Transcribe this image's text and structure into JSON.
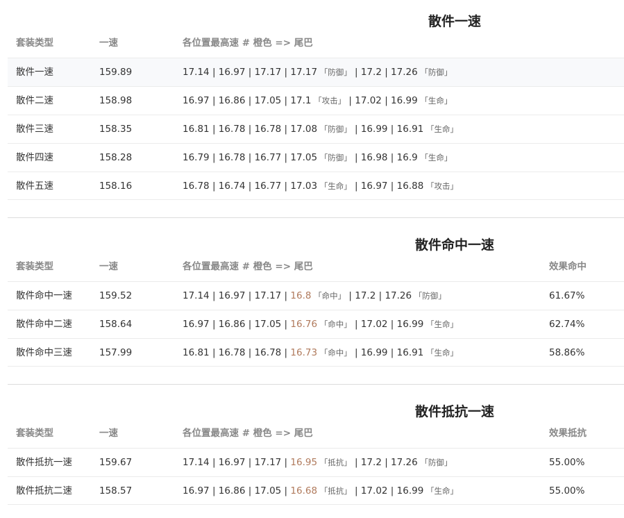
{
  "sections": [
    {
      "title": "散件一速",
      "headers": {
        "type": "套装类型",
        "speed": "一速",
        "positions": "各位置最高速 # 橙色 => 尾巴",
        "extra": ""
      },
      "rows": [
        {
          "type": "散件一速",
          "speed": "159.89",
          "parts": [
            {
              "v": "17.14"
            },
            {
              "v": "16.97"
            },
            {
              "v": "17.17"
            },
            {
              "v": "17.17",
              "tag": "「防御」"
            },
            {
              "v": "17.2"
            },
            {
              "v": "17.26",
              "tag": "「防御」"
            }
          ],
          "extra": ""
        },
        {
          "type": "散件二速",
          "speed": "158.98",
          "parts": [
            {
              "v": "16.97"
            },
            {
              "v": "16.86"
            },
            {
              "v": "17.05"
            },
            {
              "v": "17.1",
              "tag": "「攻击」"
            },
            {
              "v": "17.02"
            },
            {
              "v": "16.99",
              "tag": "「生命」"
            }
          ],
          "extra": ""
        },
        {
          "type": "散件三速",
          "speed": "158.35",
          "parts": [
            {
              "v": "16.81"
            },
            {
              "v": "16.78"
            },
            {
              "v": "16.78"
            },
            {
              "v": "17.08",
              "tag": "「防御」"
            },
            {
              "v": "16.99"
            },
            {
              "v": "16.91",
              "tag": "「生命」"
            }
          ],
          "extra": ""
        },
        {
          "type": "散件四速",
          "speed": "158.28",
          "parts": [
            {
              "v": "16.79"
            },
            {
              "v": "16.78"
            },
            {
              "v": "16.77"
            },
            {
              "v": "17.05",
              "tag": "「防御」"
            },
            {
              "v": "16.98"
            },
            {
              "v": "16.9",
              "tag": "「生命」"
            }
          ],
          "extra": ""
        },
        {
          "type": "散件五速",
          "speed": "158.16",
          "parts": [
            {
              "v": "16.78"
            },
            {
              "v": "16.74"
            },
            {
              "v": "16.77"
            },
            {
              "v": "17.03",
              "tag": "「生命」"
            },
            {
              "v": "16.97"
            },
            {
              "v": "16.88",
              "tag": "「攻击」"
            }
          ],
          "extra": ""
        }
      ]
    },
    {
      "title": "散件命中一速",
      "headers": {
        "type": "套装类型",
        "speed": "一速",
        "positions": "各位置最高速 # 橙色 => 尾巴",
        "extra": "效果命中"
      },
      "rows": [
        {
          "type": "散件命中一速",
          "speed": "159.52",
          "parts": [
            {
              "v": "17.14"
            },
            {
              "v": "16.97"
            },
            {
              "v": "17.17"
            },
            {
              "v": "16.8",
              "tag": "「命中」",
              "orange": true
            },
            {
              "v": "17.2"
            },
            {
              "v": "17.26",
              "tag": "「防御」"
            }
          ],
          "extra": "61.67%"
        },
        {
          "type": "散件命中二速",
          "speed": "158.64",
          "parts": [
            {
              "v": "16.97"
            },
            {
              "v": "16.86"
            },
            {
              "v": "17.05"
            },
            {
              "v": "16.76",
              "tag": "「命中」",
              "orange": true
            },
            {
              "v": "17.02"
            },
            {
              "v": "16.99",
              "tag": "「生命」"
            }
          ],
          "extra": "62.74%"
        },
        {
          "type": "散件命中三速",
          "speed": "157.99",
          "parts": [
            {
              "v": "16.81"
            },
            {
              "v": "16.78"
            },
            {
              "v": "16.78"
            },
            {
              "v": "16.73",
              "tag": "「命中」",
              "orange": true
            },
            {
              "v": "16.99"
            },
            {
              "v": "16.91",
              "tag": "「生命」"
            }
          ],
          "extra": "58.86%"
        }
      ]
    },
    {
      "title": "散件抵抗一速",
      "headers": {
        "type": "套装类型",
        "speed": "一速",
        "positions": "各位置最高速 # 橙色 => 尾巴",
        "extra": "效果抵抗"
      },
      "rows": [
        {
          "type": "散件抵抗一速",
          "speed": "159.67",
          "parts": [
            {
              "v": "17.14"
            },
            {
              "v": "16.97"
            },
            {
              "v": "17.17"
            },
            {
              "v": "16.95",
              "tag": "「抵抗」",
              "orange": true
            },
            {
              "v": "17.2"
            },
            {
              "v": "17.26",
              "tag": "「防御」"
            }
          ],
          "extra": "55.00%"
        },
        {
          "type": "散件抵抗二速",
          "speed": "158.57",
          "parts": [
            {
              "v": "16.97"
            },
            {
              "v": "16.86"
            },
            {
              "v": "17.05"
            },
            {
              "v": "16.68",
              "tag": "「抵抗」",
              "orange": true
            },
            {
              "v": "17.02"
            },
            {
              "v": "16.99",
              "tag": "「生命」"
            }
          ],
          "extra": "55.00%"
        }
      ]
    }
  ]
}
